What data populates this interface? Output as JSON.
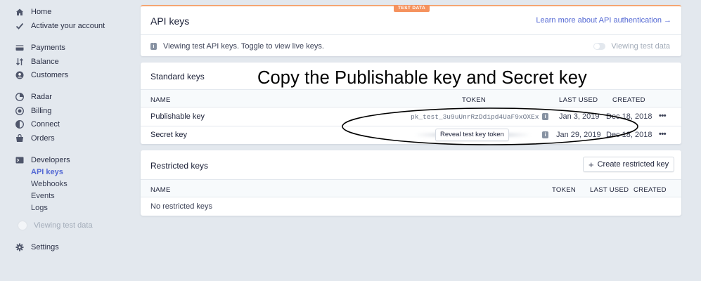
{
  "sidebar": {
    "home": "Home",
    "activate": "Activate your account",
    "payments": "Payments",
    "balance": "Balance",
    "customers": "Customers",
    "radar": "Radar",
    "billing": "Billing",
    "connect": "Connect",
    "orders": "Orders",
    "developers": "Developers",
    "api_keys": "API keys",
    "webhooks": "Webhooks",
    "events": "Events",
    "logs": "Logs",
    "viewing_test": "Viewing test data",
    "settings": "Settings"
  },
  "api_card": {
    "badge": "TEST DATA",
    "title": "API keys",
    "learn_link": "Learn more about API authentication →",
    "info": "Viewing test API keys. Toggle to view live keys.",
    "toggle_label": "Viewing test data"
  },
  "standard": {
    "title": "Standard keys",
    "headers": {
      "name": "NAME",
      "token": "TOKEN",
      "last_used": "LAST USED",
      "created": "CREATED"
    },
    "rows": [
      {
        "name": "Publishable key",
        "token": "pk_test_3u9uUnrRzDdipd4UaF9xOXEx",
        "last_used": "Jan 3, 2019",
        "created": "Dec 18, 2018"
      },
      {
        "name": "Secret key",
        "reveal": "Reveal test key token",
        "last_used": "Jan 29, 2019",
        "created": "Dec 18, 2018"
      }
    ]
  },
  "restricted": {
    "title": "Restricted keys",
    "create": "Create restricted key",
    "headers": {
      "name": "NAME",
      "token": "TOKEN",
      "last_used": "LAST USED",
      "created": "CREATED"
    },
    "empty": "No restricted keys"
  },
  "annotation": "Copy the Publishable key and Secret key",
  "colors": {
    "accent": "#5469d4",
    "test_badge": "#f5925e",
    "background": "#e3e8ee"
  }
}
